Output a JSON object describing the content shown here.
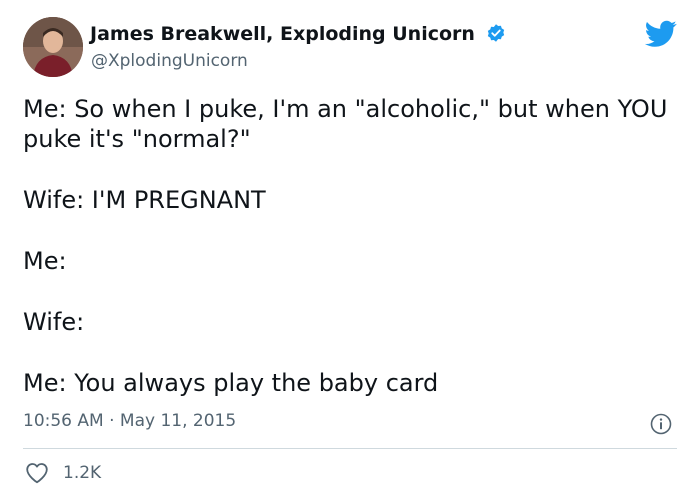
{
  "author": {
    "display_name": "James Breakwell, Exploding Unicorn",
    "handle": "@XplodingUnicorn",
    "verified": true
  },
  "tweet": {
    "lines": [
      "Me: So when I puke, I'm an \"alcoholic,\" but when YOU puke it's \"normal?\"",
      "Wife: I'M PREGNANT",
      "Me:",
      "Wife:",
      "Me: You always play the baby card"
    ],
    "timestamp": "10:56 AM · May 11, 2015",
    "like_count": "1.2K"
  },
  "icons": {
    "brand": "twitter-bird-icon",
    "verified": "verified-badge-icon",
    "info": "info-icon",
    "like": "heart-icon"
  },
  "colors": {
    "brand_blue": "#1d9bf0",
    "text_primary": "#0f1419",
    "text_secondary": "#536471",
    "divider": "#cfd9de"
  }
}
